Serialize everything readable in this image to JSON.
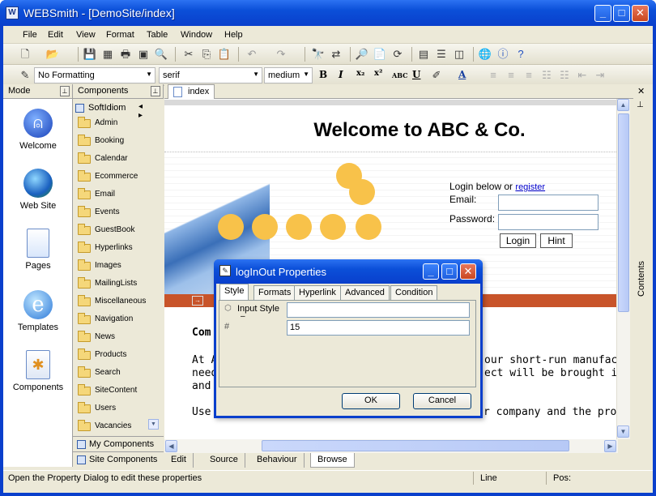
{
  "app": {
    "title": "WEBSmith - [DemoSite/index]"
  },
  "menu": [
    "File",
    "Edit",
    "View",
    "Format",
    "Table",
    "Window",
    "Help"
  ],
  "format_toolbar": {
    "style": "No Formatting",
    "font": "serif",
    "size": "medium"
  },
  "mode_panel": {
    "header": "Mode",
    "items": [
      {
        "label": "Welcome",
        "icon": "welcome-icon"
      },
      {
        "label": "Web Site",
        "icon": "globe-icon"
      },
      {
        "label": "Pages",
        "icon": "page-icon"
      },
      {
        "label": "Templates",
        "icon": "template-icon"
      },
      {
        "label": "Components",
        "icon": "components-icon"
      }
    ]
  },
  "components_panel": {
    "header": "Components",
    "root": "SoftIdiom",
    "folders": [
      "Admin",
      "Booking",
      "Calendar",
      "Ecommerce",
      "Email",
      "Events",
      "GuestBook",
      "Hyperlinks",
      "Images",
      "MailingLists",
      "Miscellaneous",
      "Navigation",
      "News",
      "Products",
      "Search",
      "SiteContent",
      "Users",
      "Vacancies"
    ],
    "my_components": "My Components",
    "site_components": "Site Components"
  },
  "editor": {
    "tab": "index",
    "page_heading": "Welcome to ABC & Co.",
    "login_prompt": "Login below or",
    "register_link": "register",
    "email_label": "Email:",
    "password_label": "Password:",
    "login_button": "Login",
    "hint_button": "Hint",
    "body_heading": "Com",
    "body_para1_a": "At A",
    "body_para1_b": "our short-run manufacturi",
    "body_para2_a": "need",
    "body_para2_b": "ect will be brought in on t",
    "body_para3_a": "and",
    "body_para4": "Use the Menu on the right to find out about our company and the products we"
  },
  "right_strip": {
    "label": "Contents"
  },
  "view_tabs": [
    "Edit",
    "Source",
    "Behaviour",
    "Browse"
  ],
  "status": {
    "message": "Open the Property Dialog to edit these properties",
    "line": "Line",
    "pos": "Pos:"
  },
  "dialog": {
    "title": "logInOut Properties",
    "tabs": [
      "Style",
      "Formats",
      "Hyperlink",
      "Advanced",
      "Condition"
    ],
    "props": [
      {
        "label": "Input Style",
        "value": ""
      },
      {
        "label": "",
        "value": "15"
      }
    ],
    "ok": "OK",
    "cancel": "Cancel"
  },
  "colors": {
    "titlebar": "#0a3fcc",
    "banner_bar": "#c8542a",
    "circle": "#f8c24a",
    "link": "#0000cc"
  }
}
